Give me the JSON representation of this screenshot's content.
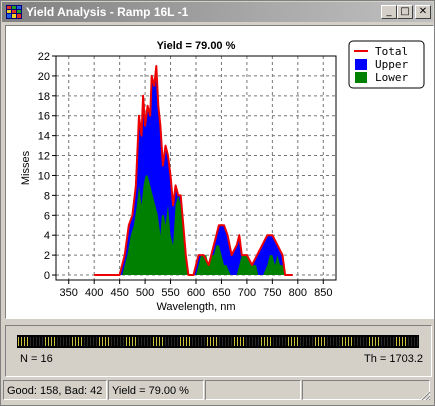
{
  "window": {
    "title": "Yield Analysis - Ramp 16L -1",
    "minimize_glyph": "_",
    "maximize_glyph": "□",
    "close_glyph": "✕",
    "icon": "app-grid-icon"
  },
  "chart_data": {
    "type": "area",
    "title": "Yield = 79.00 %",
    "xlabel": "Wavelength, nm",
    "ylabel": "Misses",
    "xlim": [
      325,
      875
    ],
    "ylim": [
      -0.5,
      22
    ],
    "x_ticks": [
      350,
      400,
      450,
      500,
      550,
      600,
      650,
      700,
      750,
      800,
      850
    ],
    "y_ticks": [
      0,
      2,
      4,
      6,
      8,
      10,
      12,
      14,
      16,
      18,
      20,
      22
    ],
    "grid": true,
    "legend_position": "top-right",
    "series": [
      {
        "name": "Total",
        "color": "#ee0000",
        "style": "line",
        "points": [
          [
            400,
            0
          ],
          [
            450,
            0
          ],
          [
            460,
            2
          ],
          [
            468,
            5
          ],
          [
            475,
            6
          ],
          [
            482,
            9
          ],
          [
            488,
            16
          ],
          [
            493,
            14
          ],
          [
            496,
            18
          ],
          [
            500,
            15
          ],
          [
            505,
            17
          ],
          [
            510,
            16
          ],
          [
            513,
            20
          ],
          [
            518,
            19
          ],
          [
            522,
            21
          ],
          [
            526,
            17
          ],
          [
            530,
            15
          ],
          [
            535,
            11
          ],
          [
            540,
            13
          ],
          [
            545,
            12
          ],
          [
            550,
            10
          ],
          [
            555,
            7
          ],
          [
            560,
            9
          ],
          [
            565,
            8
          ],
          [
            570,
            8
          ],
          [
            575,
            5
          ],
          [
            580,
            2
          ],
          [
            585,
            0
          ],
          [
            595,
            0
          ],
          [
            605,
            2
          ],
          [
            615,
            2
          ],
          [
            625,
            1
          ],
          [
            635,
            3
          ],
          [
            640,
            4
          ],
          [
            645,
            5
          ],
          [
            655,
            5
          ],
          [
            662,
            4
          ],
          [
            670,
            2
          ],
          [
            680,
            3
          ],
          [
            685,
            4
          ],
          [
            690,
            2
          ],
          [
            700,
            2
          ],
          [
            710,
            1
          ],
          [
            720,
            2
          ],
          [
            730,
            3
          ],
          [
            740,
            4
          ],
          [
            750,
            4
          ],
          [
            760,
            3
          ],
          [
            770,
            2
          ],
          [
            775,
            0
          ],
          [
            790,
            0
          ]
        ]
      },
      {
        "name": "Upper",
        "color": "#0000ff",
        "style": "area",
        "points": [
          [
            400,
            0
          ],
          [
            450,
            0
          ],
          [
            460,
            2
          ],
          [
            468,
            5
          ],
          [
            475,
            6
          ],
          [
            482,
            9
          ],
          [
            488,
            16
          ],
          [
            493,
            14
          ],
          [
            496,
            18
          ],
          [
            500,
            15
          ],
          [
            505,
            17
          ],
          [
            510,
            16
          ],
          [
            513,
            20
          ],
          [
            518,
            19
          ],
          [
            522,
            21
          ],
          [
            526,
            17
          ],
          [
            530,
            15
          ],
          [
            535,
            11
          ],
          [
            540,
            13
          ],
          [
            545,
            12
          ],
          [
            550,
            10
          ],
          [
            555,
            7
          ],
          [
            560,
            9
          ],
          [
            565,
            8
          ],
          [
            570,
            8
          ],
          [
            575,
            5
          ],
          [
            580,
            2
          ],
          [
            585,
            0
          ],
          [
            595,
            0
          ],
          [
            605,
            2
          ],
          [
            615,
            2
          ],
          [
            625,
            1
          ],
          [
            635,
            3
          ],
          [
            640,
            4
          ],
          [
            645,
            5
          ],
          [
            655,
            5
          ],
          [
            662,
            4
          ],
          [
            670,
            2
          ],
          [
            680,
            3
          ],
          [
            685,
            4
          ],
          [
            690,
            2
          ],
          [
            700,
            2
          ],
          [
            710,
            1
          ],
          [
            720,
            2
          ],
          [
            730,
            3
          ],
          [
            740,
            4
          ],
          [
            750,
            4
          ],
          [
            760,
            3
          ],
          [
            770,
            2
          ],
          [
            775,
            0
          ],
          [
            790,
            0
          ]
        ]
      },
      {
        "name": "Lower",
        "color": "#008000",
        "style": "area",
        "points": [
          [
            400,
            0
          ],
          [
            455,
            0
          ],
          [
            465,
            2
          ],
          [
            472,
            4
          ],
          [
            478,
            5
          ],
          [
            484,
            7
          ],
          [
            488,
            9
          ],
          [
            493,
            7
          ],
          [
            497,
            9
          ],
          [
            501,
            10
          ],
          [
            505,
            10
          ],
          [
            510,
            9
          ],
          [
            515,
            8
          ],
          [
            520,
            7
          ],
          [
            525,
            6
          ],
          [
            530,
            4
          ],
          [
            533,
            6
          ],
          [
            537,
            6
          ],
          [
            540,
            5
          ],
          [
            545,
            7
          ],
          [
            550,
            4
          ],
          [
            555,
            3
          ],
          [
            560,
            7
          ],
          [
            565,
            8
          ],
          [
            570,
            7
          ],
          [
            575,
            5
          ],
          [
            580,
            2
          ],
          [
            585,
            0
          ],
          [
            600,
            0
          ],
          [
            605,
            1
          ],
          [
            610,
            2
          ],
          [
            615,
            2
          ],
          [
            620,
            2
          ],
          [
            625,
            1
          ],
          [
            630,
            2
          ],
          [
            635,
            2
          ],
          [
            640,
            3
          ],
          [
            645,
            3
          ],
          [
            650,
            2
          ],
          [
            655,
            1
          ],
          [
            660,
            1
          ],
          [
            668,
            0
          ],
          [
            680,
            0
          ],
          [
            685,
            1
          ],
          [
            690,
            2
          ],
          [
            700,
            2
          ],
          [
            710,
            1
          ],
          [
            718,
            1
          ],
          [
            722,
            0
          ],
          [
            732,
            0
          ],
          [
            740,
            1
          ],
          [
            745,
            2
          ],
          [
            750,
            2
          ],
          [
            755,
            1
          ],
          [
            760,
            2
          ],
          [
            765,
            1
          ],
          [
            770,
            1
          ],
          [
            775,
            0
          ],
          [
            790,
            0
          ]
        ]
      }
    ]
  },
  "strip": {
    "n_label": "N = 16",
    "th_label": "Th = 1703.2"
  },
  "status": {
    "good_bad": "Good: 158, Bad: 42",
    "yield": "Yield = 79.00 %",
    "empty1": "",
    "empty2": ""
  }
}
